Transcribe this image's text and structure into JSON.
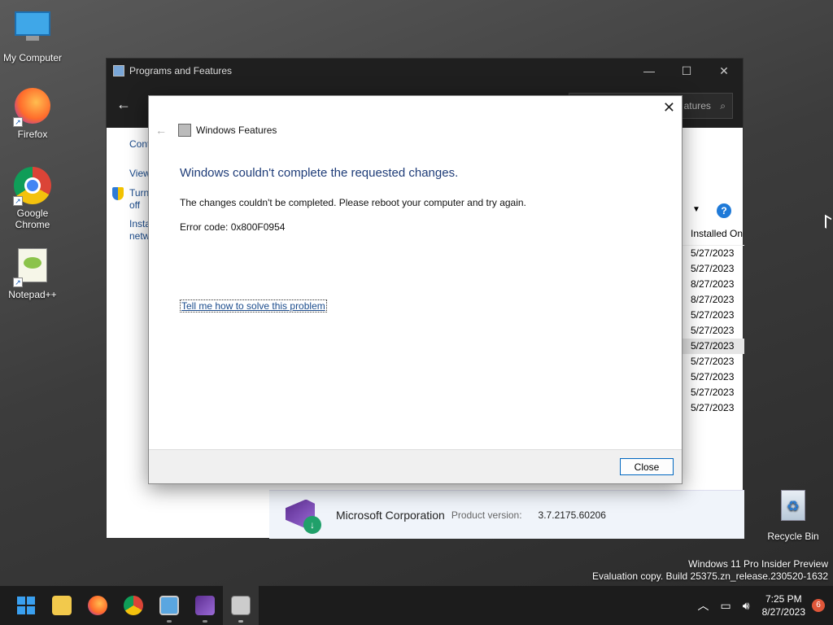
{
  "desktop": {
    "icons": [
      {
        "label": "My Computer"
      },
      {
        "label": "Firefox"
      },
      {
        "label": "Google Chrome"
      },
      {
        "label": "Notepad++"
      },
      {
        "label": "Recycle Bin"
      }
    ],
    "watermark": {
      "line1": "Windows 11 Pro Insider Preview",
      "line2": "Evaluation copy. Build 25375.zn_release.230520-1632"
    }
  },
  "explorer": {
    "title": "Programs and Features",
    "search_placeholder": "atures",
    "sidebar": {
      "line1": "Cont",
      "line2": "View",
      "line3a": "Turn",
      "line3b": "off",
      "line4a": "Insta",
      "line4b": "netw"
    },
    "column_header": "Installed On",
    "rows": [
      "5/27/2023",
      "5/27/2023",
      "8/27/2023",
      "8/27/2023",
      "5/27/2023",
      "5/27/2023",
      "5/27/2023",
      "5/27/2023",
      "5/27/2023",
      "5/27/2023",
      "5/27/2023"
    ],
    "selected_row": 6,
    "details": {
      "company": "Microsoft Corporation",
      "product_version_label": "Product version:",
      "product_version": "3.7.2175.60206"
    }
  },
  "dialog": {
    "title": "Windows Features",
    "heading": "Windows couldn't complete the requested changes.",
    "message": "The changes couldn't be completed. Please reboot your computer and try again.",
    "error": "Error code: 0x800F0954",
    "link": "Tell me how to solve this problem",
    "close_label": "Close"
  },
  "taskbar": {
    "time": "7:25 PM",
    "date": "8/27/2023",
    "notifications": "6"
  },
  "colors": {
    "accent": "#0067c0",
    "heading": "#1e3c78",
    "link": "#1a4b8c"
  }
}
